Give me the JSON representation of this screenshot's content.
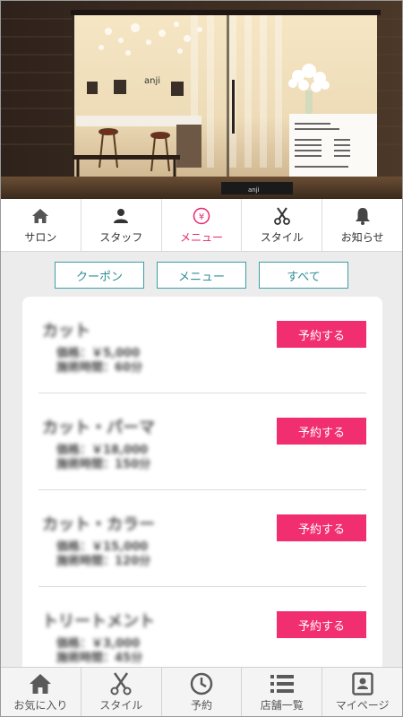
{
  "hero": {
    "shop_logo_text": "anji"
  },
  "tabs": [
    {
      "label": "サロン",
      "icon": "home-icon",
      "active": false
    },
    {
      "label": "スタッフ",
      "icon": "person-icon",
      "active": false
    },
    {
      "label": "メニュー",
      "icon": "yen-icon",
      "active": true
    },
    {
      "label": "スタイル",
      "icon": "scissors-icon",
      "active": false
    },
    {
      "label": "お知らせ",
      "icon": "bell-icon",
      "active": false
    }
  ],
  "filters": [
    "クーポン",
    "メニュー",
    "すべて"
  ],
  "menu_items": [
    {
      "name": "カット",
      "price": "価格：￥5,000",
      "time": "施術時間：60分",
      "button": "予約する"
    },
    {
      "name": "カット・パーマ",
      "price": "価格：￥18,000",
      "time": "施術時間：150分",
      "button": "予約する"
    },
    {
      "name": "カット・カラー",
      "price": "価格：￥15,000",
      "time": "施術時間：120分",
      "button": "予約する"
    },
    {
      "name": "トリートメント",
      "price": "価格：￥3,000",
      "time": "施術時間：45分",
      "button": "予約する"
    }
  ],
  "bottom_nav": [
    {
      "label": "お気に入り",
      "icon": "home-icon"
    },
    {
      "label": "スタイル",
      "icon": "scissors-icon"
    },
    {
      "label": "予約",
      "icon": "clock-icon"
    },
    {
      "label": "店舗一覧",
      "icon": "list-icon"
    },
    {
      "label": "マイページ",
      "icon": "id-card-icon"
    }
  ],
  "colors": {
    "accent_pink": "#f12f70",
    "active_tab": "#e8266e",
    "filter_teal": "#3aa0a8"
  }
}
